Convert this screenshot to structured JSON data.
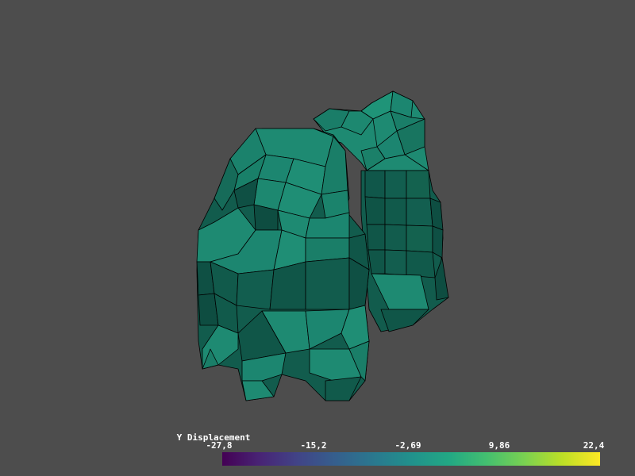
{
  "scalar_bar": {
    "title": "Y Displacement",
    "tick_labels": [
      "-27,8",
      "-15,2",
      "-2,69",
      "9,86",
      "22,4"
    ],
    "range": [
      -27.8,
      22.4
    ],
    "colormap": "viridis"
  },
  "colors": {
    "background": "#4d4d4d",
    "mesh_face_light": "#1e8a72",
    "mesh_face_mid": "#17705d",
    "mesh_face_dark": "#0f4e42",
    "mesh_edge": "#000000"
  }
}
